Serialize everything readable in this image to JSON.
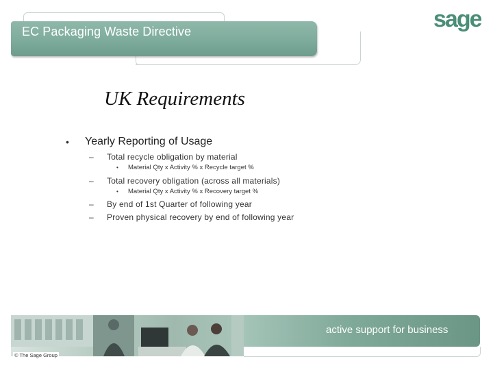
{
  "header": {
    "title": "EC Packaging Waste Directive"
  },
  "logo": {
    "text": "sage",
    "color": "#4a8e76"
  },
  "slide": {
    "title": "UK Requirements",
    "bullet": "Yearly Reporting of Usage",
    "items": [
      {
        "text": "Total recycle obligation by material",
        "sub": "Material Qty x Activity % x Recycle target %"
      },
      {
        "text": "Total recovery obligation (across all materials)",
        "sub": "Material Qty x Activity % x Recovery target %"
      },
      {
        "text": "By end of 1st Quarter of following year"
      },
      {
        "text": "Proven physical recovery by end of following year"
      }
    ]
  },
  "footer": {
    "tagline": "active support for business",
    "copyright": "© The Sage Group"
  },
  "colors": {
    "header_green": "#7eac9c",
    "band_green": "#7fa999"
  }
}
